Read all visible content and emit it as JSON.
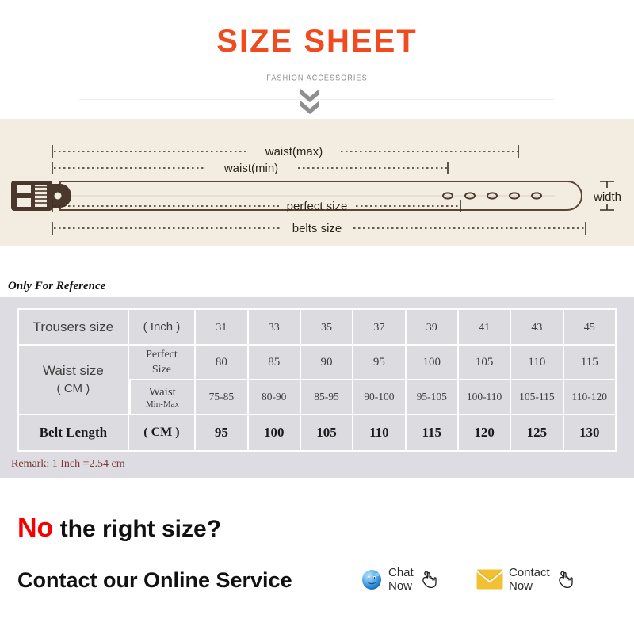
{
  "header": {
    "title": "SIZE SHEET",
    "subtitle": "FASHION ACCESSORIES",
    "chevron_icon": "double-chevron-down-icon",
    "title_color": "#f04a1e"
  },
  "diagram": {
    "labels": {
      "waist_max": "waist(max)",
      "waist_min": "waist(min)",
      "perfect_size": "perfect size",
      "belts_size": "belts size",
      "width": "width"
    },
    "band_color": "#f3ede1",
    "belt_color": "#4a382c",
    "holes": 5
  },
  "reference_note": "Only For Reference",
  "table": {
    "rows": [
      {
        "label": "Trousers size",
        "unit": "( Inch )",
        "values": [
          "31",
          "33",
          "35",
          "37",
          "39",
          "41",
          "43",
          "45"
        ]
      },
      {
        "label": "Waist size",
        "label_sub": "( CM )",
        "unit": "Perfect",
        "unit_sub": "Size",
        "values": [
          "80",
          "85",
          "90",
          "95",
          "100",
          "105",
          "110",
          "115"
        ]
      },
      {
        "unit": "Waist",
        "unit_sub": "Min-Max",
        "values": [
          "75-85",
          "80-90",
          "85-95",
          "90-100",
          "95-105",
          "100-110",
          "105-115",
          "110-120"
        ]
      },
      {
        "label": "Belt Length",
        "unit": "( CM )",
        "values": [
          "95",
          "100",
          "105",
          "110",
          "115",
          "120",
          "125",
          "130"
        ]
      }
    ]
  },
  "remark": "Remark: 1 Inch =2.54 cm",
  "bottom": {
    "no_word": "No",
    "headline_rest": " the right size?",
    "contact_line": "Contact our Online Service",
    "chat_label": "Chat Now",
    "contact_label": "Contact Now",
    "chat_icon": "qq-chat-icon",
    "mail_icon": "envelope-icon",
    "hand_icon": "pointing-hand-icon",
    "no_color": "#f70000"
  }
}
